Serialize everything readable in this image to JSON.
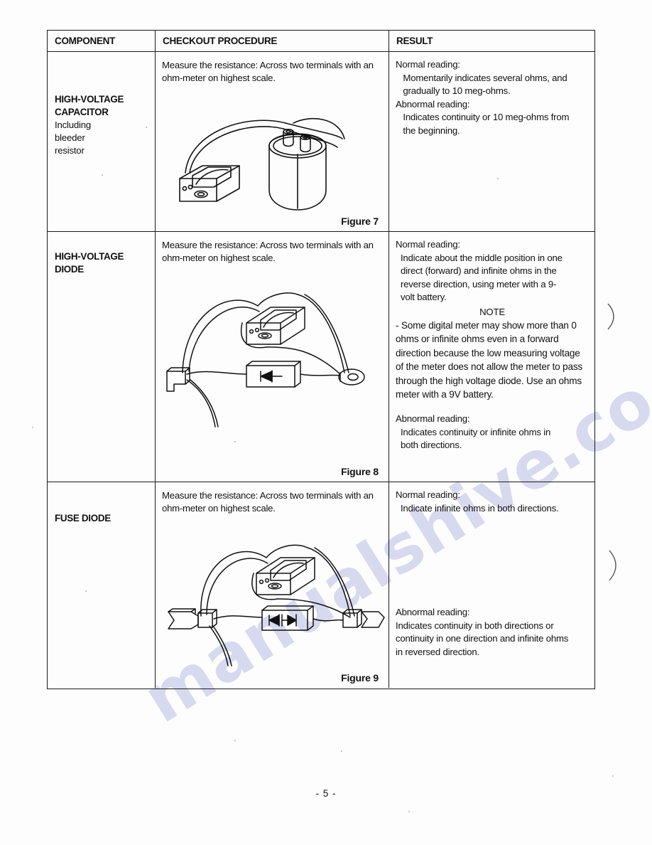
{
  "document": {
    "page_number": "- 5 -",
    "watermark_text_1": "manualshive.co",
    "watermark_text_2": "m"
  },
  "table": {
    "headers": {
      "component": "COMPONENT",
      "procedure": "CHECKOUT PROCEDURE",
      "result": "RESULT"
    },
    "rows": [
      {
        "component_title_line1": "HIGH-VOLTAGE",
        "component_title_line2": "CAPACITOR",
        "component_sub_line1": "Including",
        "component_sub_line2": "bleeder",
        "component_sub_line3": "resistor",
        "procedure": "Measure the resistance: Across two terminals with an ohm-meter on highest scale.",
        "result": "Normal reading:\n   Momentarily indicates several ohms, and\n   gradually to 10 meg-ohms.\nAbnormal reading:\n   Indicates continuity or 10 meg-ohms from\n   the beginning.",
        "figure_label": "Figure 7",
        "figure_name": "capacitor-ohmmeter-diagram"
      },
      {
        "component_title_line1": "HIGH-VOLTAGE",
        "component_title_line2": "DIODE",
        "component_sub_line1": "",
        "component_sub_line2": "",
        "component_sub_line3": "",
        "procedure": "Measure the resistance: Across two terminals with an ohm-meter on highest scale.",
        "result_part1": "Normal reading:\n  Indicate about the middle position in one\n  direct (forward) and infinite ohms in the\n  reverse direction, using meter with a 9-\n  volt battery.",
        "result_note_heading": "NOTE",
        "result_note_body": "- Some digital meter may show more than 0 ohms or infinite ohms even in a forward direction because the low measuring voltage of the meter does not allow the meter to pass through the high voltage diode. Use an ohms meter with a 9V battery.",
        "result_part2": "Abnormal reading:\n  Indicates continuity or infinite ohms in\n  both directions.",
        "figure_label": "Figure 8",
        "figure_name": "high-voltage-diode-ohmmeter-diagram"
      },
      {
        "component_title_line1": "FUSE DIODE",
        "component_title_line2": "",
        "component_sub_line1": "",
        "component_sub_line2": "",
        "component_sub_line3": "",
        "procedure": "Measure the resistance: Across two terminals with an ohm-meter on highest scale.",
        "result_part1": "Normal reading:\n  Indicate infinite ohms in both directions.",
        "result_part2": "Abnormal reading:\nIndicates continuity in both directions or\ncontinuity in one direction and infinite ohms\nin reversed direction.",
        "figure_label": "Figure 9",
        "figure_name": "fuse-diode-ohmmeter-diagram"
      }
    ]
  },
  "colors": {
    "ink": "#1a1a1a",
    "paper": "#fdfdfd",
    "watermark": "#b9bce4"
  }
}
